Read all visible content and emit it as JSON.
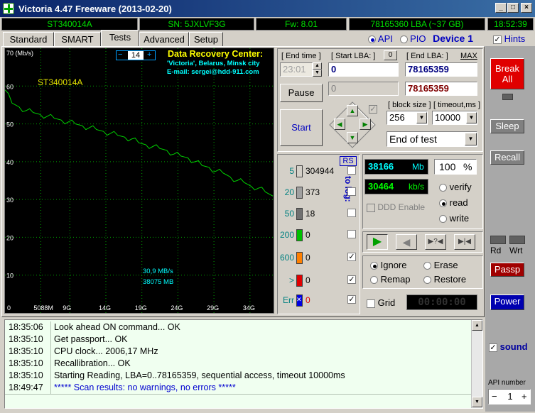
{
  "window": {
    "title": "Victoria 4.47  Freeware (2013-02-20)",
    "minimize": "_",
    "maximize": "□",
    "close": "×"
  },
  "info": {
    "model": "ST340014A",
    "serial": "SN: 5JXLVF3G",
    "firmware": "Fw: 8.01",
    "lba": "78165360 LBA (~37 GB)",
    "clock": "18:52:39"
  },
  "tabs": [
    "Standard",
    "SMART",
    "Tests",
    "Advanced",
    "Setup"
  ],
  "active_tab": "Tests",
  "mode": {
    "api": "API",
    "pio": "PIO",
    "device": "Device 1",
    "hints": "Hints"
  },
  "graph": {
    "ylabel": "70 (Mb/s)",
    "drive_label": "ST340014A",
    "scale_minus": "−",
    "scale_value": "14",
    "scale_plus": "+",
    "drc_title": "Data Recovery Center:",
    "drc_line1": "'Victoria', Belarus, Minsk city",
    "drc_line2": "E-mail: sergei@hdd-911.com",
    "speed_readout": "30,9 MB/s",
    "pos_readout": "38075 MB",
    "color_line": "#00d000",
    "color_grid": "#00a000"
  },
  "chart_data": {
    "type": "line",
    "title": "",
    "xlabel": "",
    "ylabel": "70 (Mb/s)",
    "x_tick_labels": [
      "0",
      "5088M",
      "9G",
      "14G",
      "19G",
      "24G",
      "29G",
      "34G"
    ],
    "x_tick_values": [
      0,
      5088,
      9216,
      14336,
      19456,
      24576,
      29696,
      34816
    ],
    "y_tick_labels": [
      "60",
      "50",
      "40",
      "30",
      "20",
      "10"
    ],
    "y_tick_values": [
      60,
      50,
      40,
      30,
      20,
      10
    ],
    "xlim": [
      0,
      38166
    ],
    "ylim": [
      0,
      70
    ],
    "grid": true,
    "series": [
      {
        "name": "",
        "x": [
          0,
          1000,
          2000,
          3000,
          4000,
          5000,
          6000,
          7000,
          8000,
          9000,
          10000,
          11000,
          12000,
          13000,
          14000,
          15000,
          16000,
          17000,
          18000,
          19000,
          20000,
          21000,
          22000,
          23000,
          24000,
          25000,
          26000,
          27000,
          28000,
          29000,
          30000,
          31000,
          32000,
          33000,
          34000,
          35000,
          36000,
          37000,
          38075
        ],
        "y": [
          59,
          55.5,
          54.5,
          53.5,
          53,
          52.5,
          52,
          51.5,
          51,
          50.5,
          50,
          49.5,
          49,
          48.5,
          48,
          47.5,
          47,
          46.5,
          46,
          45,
          44.5,
          44,
          43.5,
          43,
          42,
          41.5,
          41,
          40,
          39,
          38.5,
          37.5,
          37,
          36,
          35,
          34.5,
          33.5,
          33,
          32,
          30.9
        ]
      }
    ]
  },
  "lba": {
    "end_time_label": "[ End time ]",
    "end_time_value": "23:01",
    "start_lba_label": "[ Start LBA: ]",
    "start_reset": "0",
    "end_lba_label": "[ End LBA: ]",
    "max_label": "MAX",
    "start_lba_value": "0",
    "end_lba_value": "78165359",
    "current_value": "0",
    "current_end_value": "78165359"
  },
  "controls": {
    "pause": "Pause",
    "start": "Start",
    "block_size_label": "[ block size ]",
    "block_size_value": "256",
    "timeout_label": "[ timeout,ms ]",
    "timeout_value": "10000",
    "end_mode": "End of test"
  },
  "blocks": {
    "rs": "RS",
    "to_log": "to log:",
    "rows": [
      {
        "label": "5",
        "count": "304944",
        "color": "#d4d0c8",
        "checked": ""
      },
      {
        "label": "20",
        "count": "373",
        "color": "#a0a0a0",
        "checked": ""
      },
      {
        "label": "50",
        "count": "18",
        "color": "#707070",
        "checked": ""
      },
      {
        "label": "200",
        "count": "0",
        "color": "#00c000",
        "checked": ""
      },
      {
        "label": "600",
        "count": "0",
        "color": "#ff8000",
        "checked": "✓"
      },
      {
        "label": ">",
        "count": "0",
        "color": "#e00000",
        "checked": "✓"
      },
      {
        "label": "Err",
        "count": "0",
        "color": "#0000e0",
        "checked": "✓"
      }
    ],
    "err_mark": "✕"
  },
  "stats": {
    "mb": "38166",
    "mb_unit": "Mb",
    "percent": "100",
    "percent_unit": "%",
    "speed": "30464",
    "speed_unit": "kb/s",
    "ddd": "DDD Enable",
    "verify": "verify",
    "read": "read",
    "write": "write"
  },
  "playback": {
    "play": "▶",
    "back": "◀",
    "skip": "▶?◀",
    "end": "▶|◀"
  },
  "actions": {
    "ignore": "Ignore",
    "erase": "Erase",
    "remap": "Remap",
    "restore": "Restore",
    "grid": "Grid",
    "timer": "00:00:00"
  },
  "side": {
    "break_all": "Break All",
    "sleep": "Sleep",
    "recall": "Recall",
    "rd": "Rd",
    "wrt": "Wrt",
    "passp": "Passp",
    "power": "Power",
    "sound": "sound",
    "api_number_label": "API number",
    "api_number_value": "1",
    "api_minus": "−",
    "api_plus": "+"
  },
  "log": [
    {
      "time": "18:35:06",
      "msg": "Look ahead ON command... OK",
      "color": "#000000"
    },
    {
      "time": "18:35:10",
      "msg": "Get passport... OK",
      "color": "#000000"
    },
    {
      "time": "18:35:10",
      "msg": "CPU clock... 2006,17 MHz",
      "color": "#000000"
    },
    {
      "time": "18:35:10",
      "msg": "Recallibration... OK",
      "color": "#000000"
    },
    {
      "time": "18:35:10",
      "msg": "Starting Reading, LBA=0..78165359, sequential access, timeout 10000ms",
      "color": "#000000"
    },
    {
      "time": "18:49:47",
      "msg": "***** Scan results: no warnings, no errors *****",
      "color": "#0000d0"
    }
  ]
}
